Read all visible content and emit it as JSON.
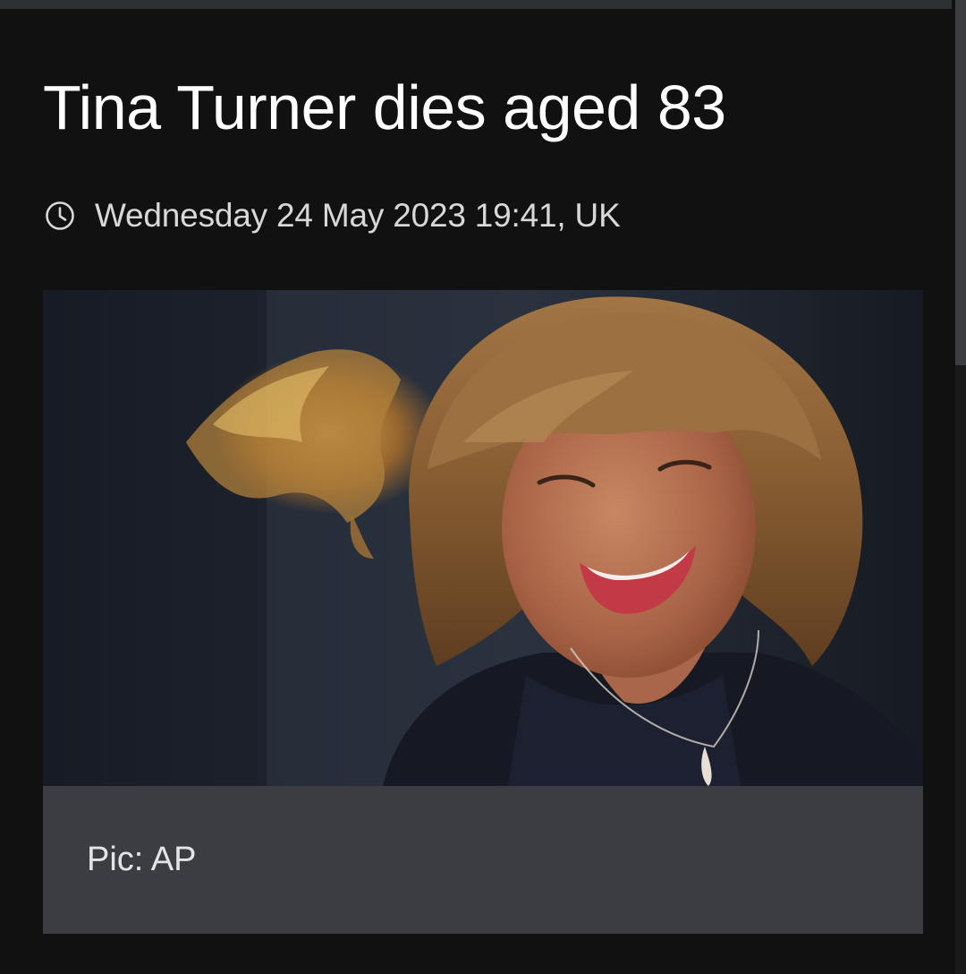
{
  "article": {
    "headline": "Tina Turner dies aged 83",
    "timestamp": "Wednesday 24 May 2023 19:41, UK",
    "timestamp_icon": "clock-icon",
    "image_caption": "Pic: AP"
  },
  "colors": {
    "background": "#111111",
    "caption_background": "#3c3d42",
    "headline_text": "#ffffff",
    "meta_text": "#d8d8d8"
  }
}
